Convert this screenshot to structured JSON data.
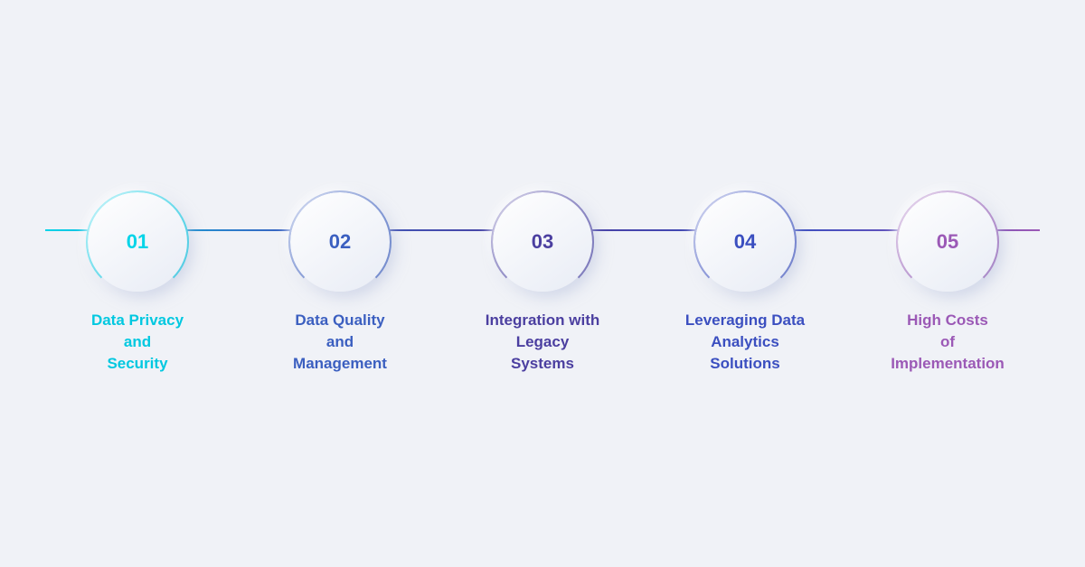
{
  "items": [
    {
      "id": "01",
      "label": "Data Privacy\nand\nSecurity",
      "colorClass": "item-1",
      "accentColor": "#00d4e8"
    },
    {
      "id": "02",
      "label": "Data Quality\nand\nManagement",
      "colorClass": "item-2",
      "accentColor": "#3b5fc0"
    },
    {
      "id": "03",
      "label": "Integration with\nLegacy\nSystems",
      "colorClass": "item-3",
      "accentColor": "#4b3fa0"
    },
    {
      "id": "04",
      "label": "Leveraging Data\nAnalytics\nSolutions",
      "colorClass": "item-4",
      "accentColor": "#3b4fc0"
    },
    {
      "id": "05",
      "label": "High Costs\nof\nImplementation",
      "colorClass": "item-5",
      "accentColor": "#9b59b6"
    }
  ]
}
